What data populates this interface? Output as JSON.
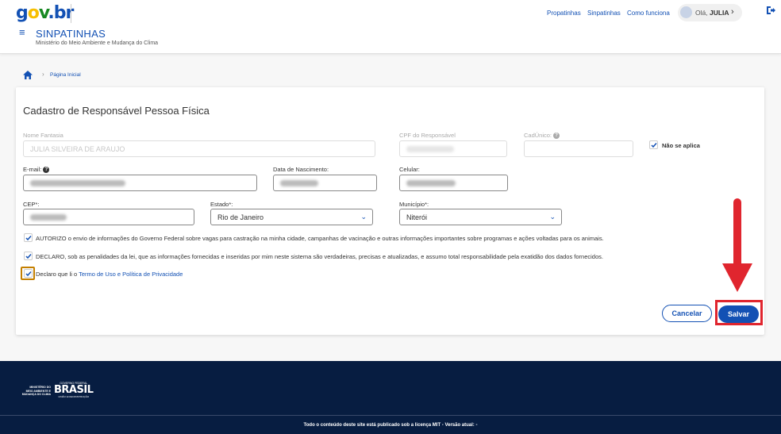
{
  "header": {
    "logo": {
      "g": "g",
      "o": "o",
      "v": "v",
      "dot": ".",
      "br": "br"
    },
    "system_title": "SINPATINHAS",
    "system_subtitle": "Ministério do Meio Ambiente e Mudança do Clima",
    "links": [
      "Propatinhas",
      "Sinpatinhas",
      "Como funciona"
    ],
    "user_greeting": "Olá,",
    "user_name": "JULIA"
  },
  "breadcrumb": {
    "current": "Página Inicial"
  },
  "form": {
    "title": "Cadastro de Responsável Pessoa Física",
    "nome_fantasia": {
      "label": "Nome Fantasia",
      "value": "JULIA SILVEIRA DE ARAUJO"
    },
    "cpf": {
      "label": "CPF do Responsável",
      "value": ""
    },
    "cadunico": {
      "label": "CadÚnico:",
      "value": ""
    },
    "nao_se_aplica": {
      "label": "Não se aplica",
      "checked": true
    },
    "email": {
      "label": "E-mail:"
    },
    "data_nascimento": {
      "label": "Data de Nascimento:"
    },
    "celular": {
      "label": "Celular:"
    },
    "cep": {
      "label": "CEP*:"
    },
    "estado": {
      "label": "Estado*:",
      "value": "Rio de Janeiro"
    },
    "municipio": {
      "label": "Município*:",
      "value": "Niterói"
    },
    "consent_1": "AUTORIZO o envio de informações do Governo Federal sobre vagas para castração na minha cidade, campanhas de vacinação e outras informações importantes sobre programas e ações voltadas para os animais.",
    "consent_2": "DECLARO, sob as penalidades da lei, que as informações fornecidas e inseridas por mim neste sistema são verdadeiras, precisas e atualizadas, e assumo total responsabilidade pela exatidão dos dados fornecidos.",
    "consent_3_prefix": "Declaro que li o",
    "consent_3_link": "Termo de Uso e Política de Privacidade",
    "cancel_label": "Cancelar",
    "save_label": "Salvar"
  },
  "footer": {
    "ministry_lines": [
      "MINISTÉRIO DO",
      "MEIO AMBIENTE E",
      "MUDANÇA DO CLIMA"
    ],
    "gov_small": "GOVERNO FEDERAL",
    "gov_big": "BRASIL",
    "gov_sub": "UNIÃO E RECONSTRUÇÃO",
    "license_text": "Todo o conteúdo deste site está publicado sob a licença MIT - Versão atual: -"
  },
  "colors": {
    "primary": "#1351b4",
    "footer_bg": "#071d41",
    "highlight_red": "#e0252e",
    "checkbox_focus": "#c47f00"
  }
}
